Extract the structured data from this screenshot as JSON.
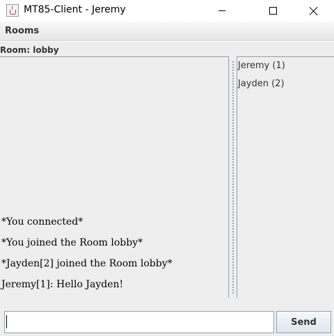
{
  "window": {
    "title": "MT85-Client - Jeremy",
    "icon": "java-cup-icon"
  },
  "menu": {
    "items": [
      {
        "label": "Rooms"
      }
    ]
  },
  "room": {
    "title": "Room: lobby"
  },
  "chat": {
    "messages": [
      "*You connected*",
      "*You joined the Room lobby*",
      "*Jayden[2] joined the Room lobby*",
      "Jeremy[1]: Hello Jayden!"
    ]
  },
  "users": [
    "Jeremy (1)",
    "Jayden (2)"
  ],
  "composer": {
    "input_value": "",
    "send_label": "Send"
  }
}
